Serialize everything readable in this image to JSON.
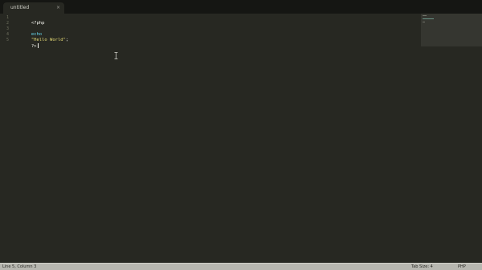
{
  "tab": {
    "title": "untitled",
    "close_icon": "close-icon",
    "close_glyph": "×"
  },
  "editor": {
    "line_numbers": [
      "1",
      "2",
      "3",
      "4",
      "5"
    ],
    "lines": {
      "l1": "<?php",
      "l3_keyword": "echo",
      "l3_string": "\"Hello World\"",
      "l3_end": ";",
      "l5": "?>"
    },
    "theme": {
      "background": "#272822",
      "keyword": "#66d9ef",
      "string": "#e6db74",
      "text": "#f8f8f2"
    }
  },
  "statusbar": {
    "position": "Line 5, Column 3",
    "tab_size": "Tab Size: 4",
    "syntax": "PHP"
  }
}
